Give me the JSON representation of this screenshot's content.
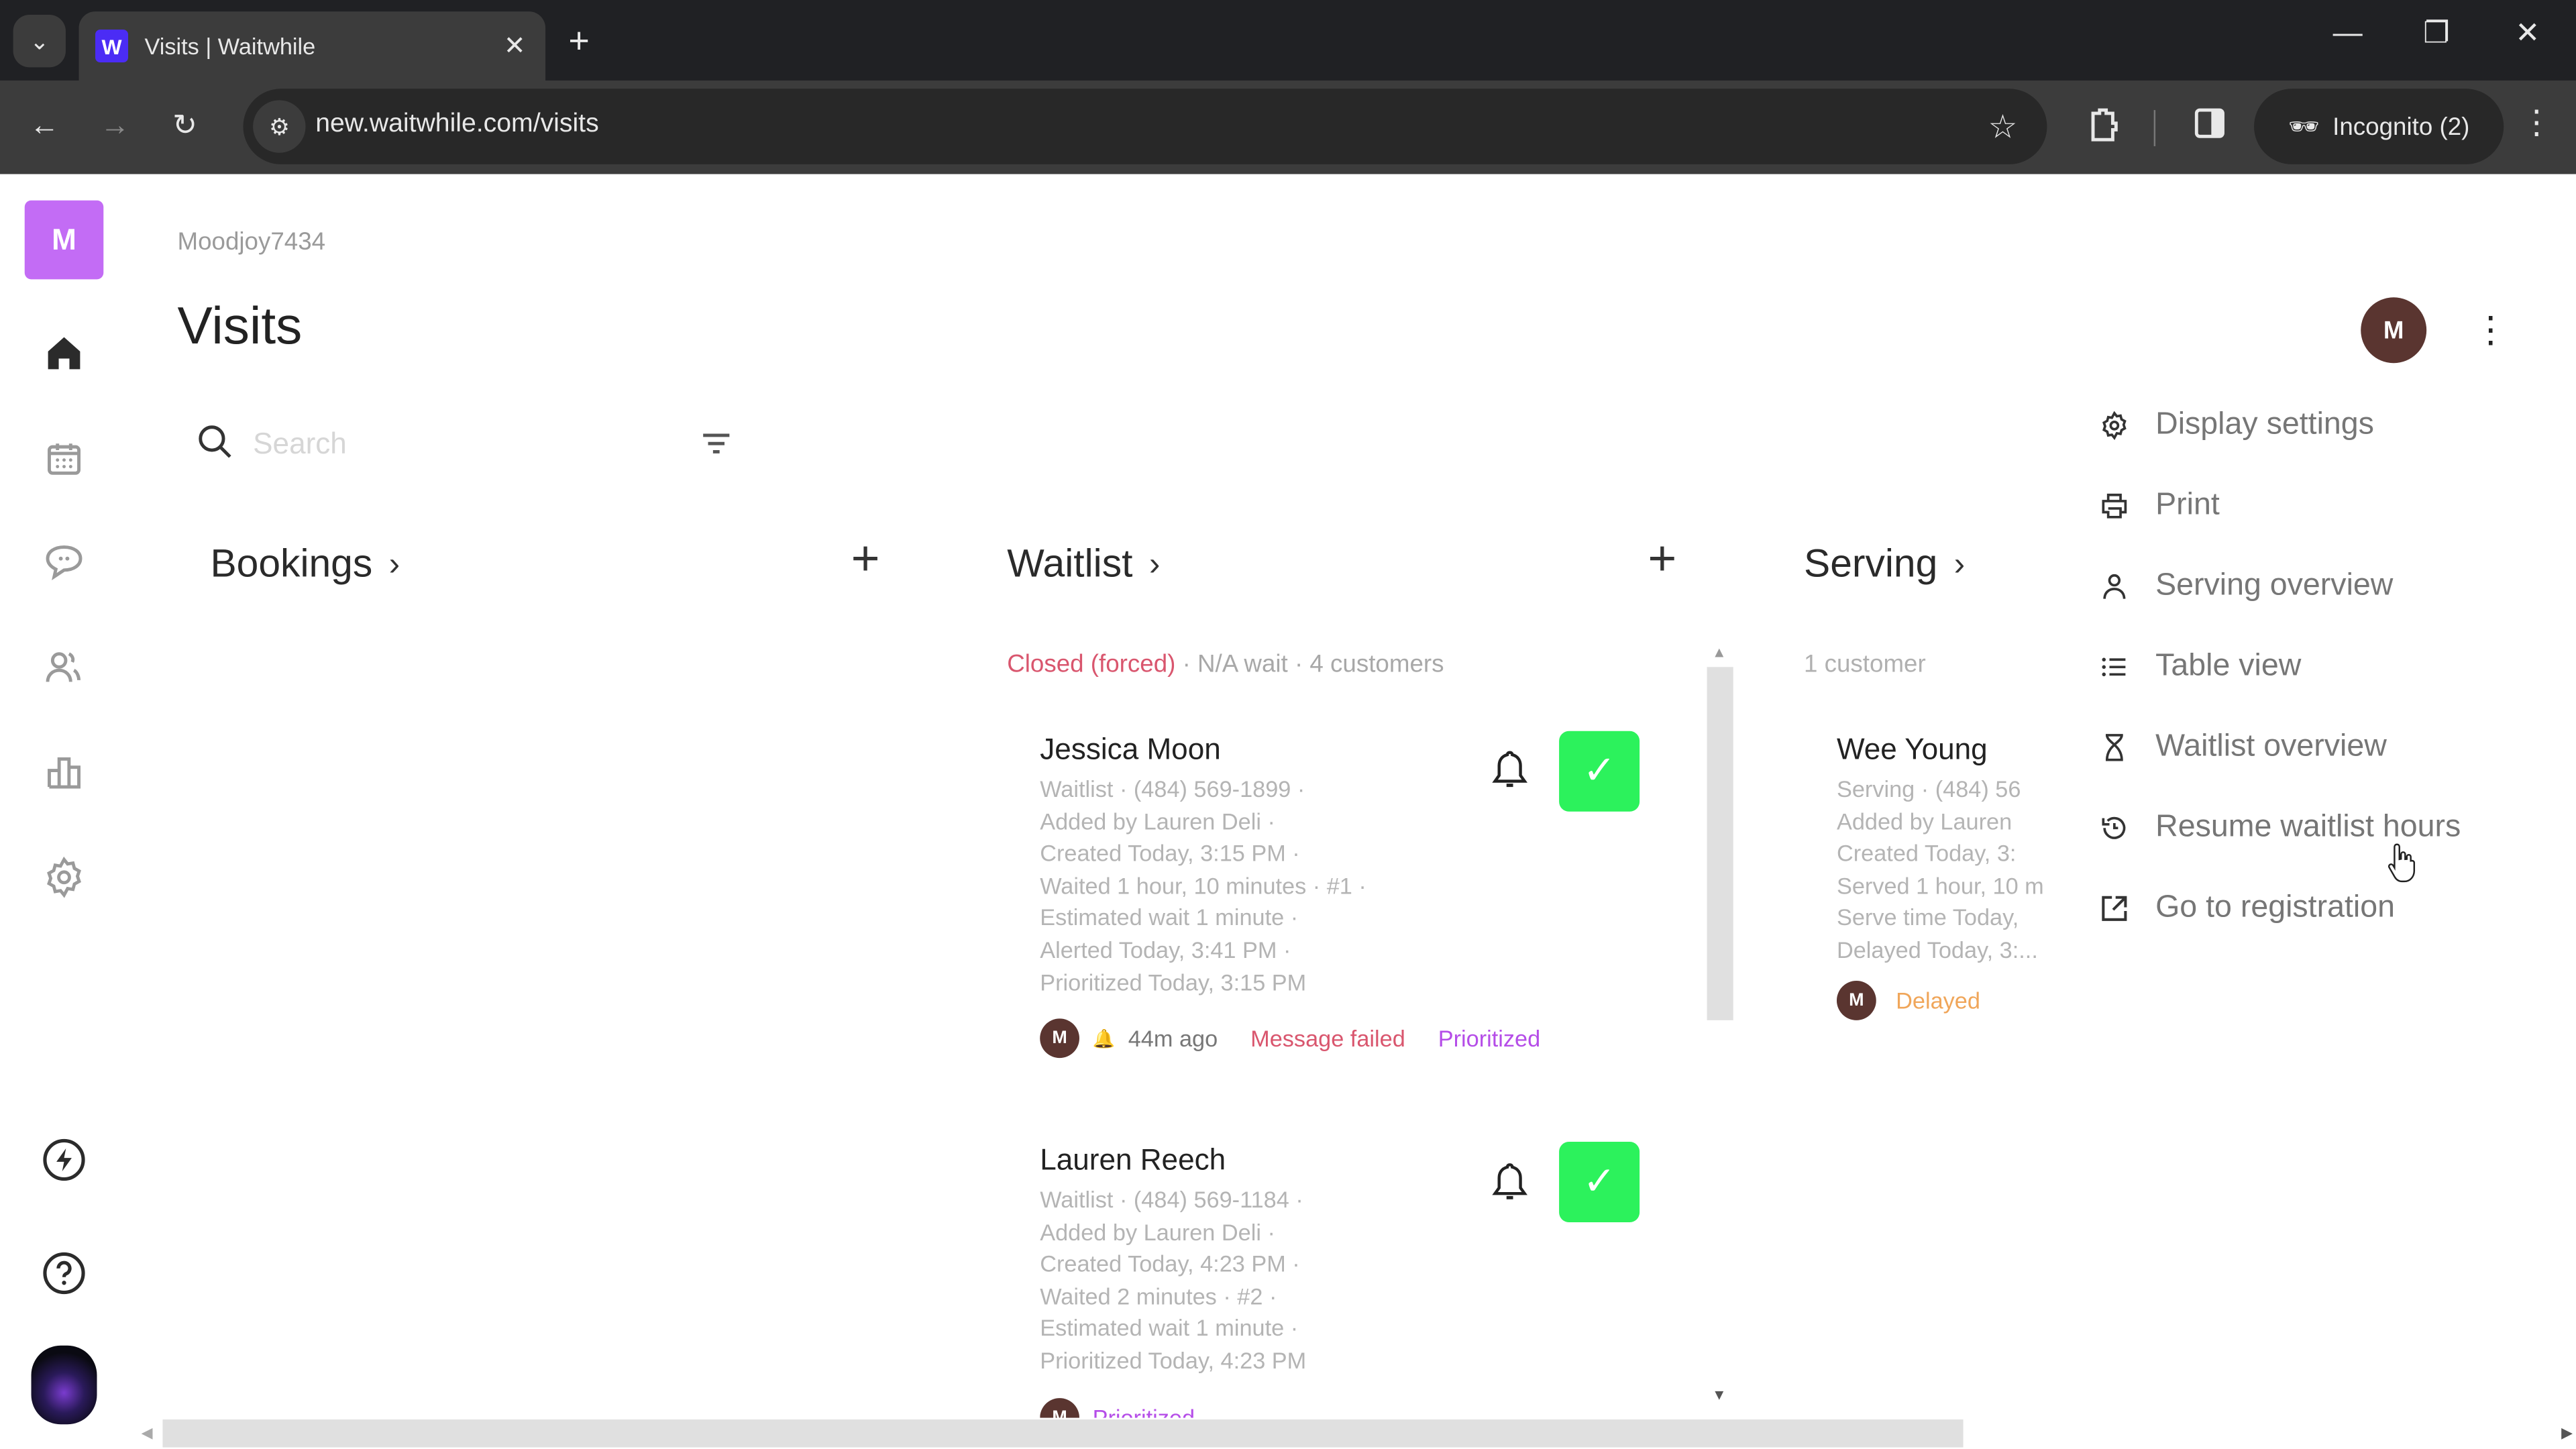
{
  "browser": {
    "tab_title": "Visits | Waitwhile",
    "favicon_letter": "W",
    "url": "new.waitwhile.com/visits",
    "incognito_label": "Incognito (2)"
  },
  "app": {
    "brand_letter": "M",
    "org_name": "Moodjoy7434",
    "page_title": "Visits",
    "user_initial": "M",
    "search": {
      "placeholder": "Search",
      "value": ""
    },
    "sidebar": [
      {
        "name": "home",
        "active": true
      },
      {
        "name": "calendar"
      },
      {
        "name": "messages"
      },
      {
        "name": "customers"
      },
      {
        "name": "analytics"
      },
      {
        "name": "settings"
      },
      {
        "name": "whats-new"
      },
      {
        "name": "help"
      }
    ],
    "columns": {
      "bookings": {
        "title": "Bookings"
      },
      "waitlist": {
        "title": "Waitlist",
        "status_closed": "Closed (forced)",
        "status_rest": " · N/A wait · 4 customers",
        "cards": [
          {
            "name": "Jessica Moon",
            "lines": [
              "Waitlist · (484) 569-1899 ·",
              "Added by Lauren Deli ·",
              "Created Today, 3:15 PM ·",
              "Waited 1 hour, 10 minutes · #1 ·",
              "Estimated wait 1 minute ·",
              "Alerted Today, 3:41 PM ·",
              "Prioritized Today, 3:15 PM"
            ],
            "staff_initial": "M",
            "alert_ago": "44m ago",
            "badge_failed": "Message failed",
            "badge_prioritized": "Prioritized"
          },
          {
            "name": "Lauren Reech",
            "lines": [
              "Waitlist · (484) 569-1184 ·",
              "Added by Lauren Deli ·",
              "Created Today, 4:23 PM ·",
              "Waited 2 minutes · #2 ·",
              "Estimated wait 1 minute ·",
              "Prioritized Today, 4:23 PM"
            ],
            "staff_initial": "M",
            "badge_prioritized": "Prioritized"
          }
        ]
      },
      "serving": {
        "title": "Serving",
        "count": "1 customer",
        "cards": [
          {
            "name": "Wee Young",
            "lines": [
              "Serving · (484) 56",
              "Added by Lauren",
              "Created Today, 3:",
              "Served 1 hour, 10 m",
              "Serve time Today,",
              "Delayed Today, 3:..."
            ],
            "staff_initial": "M",
            "badge_delayed": "Delayed"
          }
        ]
      }
    },
    "menu": [
      {
        "label": "Display settings",
        "icon": "gear-icon"
      },
      {
        "label": "Print",
        "icon": "printer-icon"
      },
      {
        "label": "Serving overview",
        "icon": "person-icon"
      },
      {
        "label": "Table view",
        "icon": "list-icon"
      },
      {
        "label": "Waitlist overview",
        "icon": "hourglass-icon"
      },
      {
        "label": "Resume waitlist hours",
        "icon": "history-icon"
      },
      {
        "label": "Go to registration",
        "icon": "external-link-icon"
      }
    ],
    "colors": {
      "brand": "#c36cf5",
      "check_green": "#2cf25c",
      "closed_red": "#d9566e",
      "prioritized_purple": "#b54de8",
      "delayed_orange": "#f0a65a",
      "avatar_brown": "#5a3530"
    }
  }
}
